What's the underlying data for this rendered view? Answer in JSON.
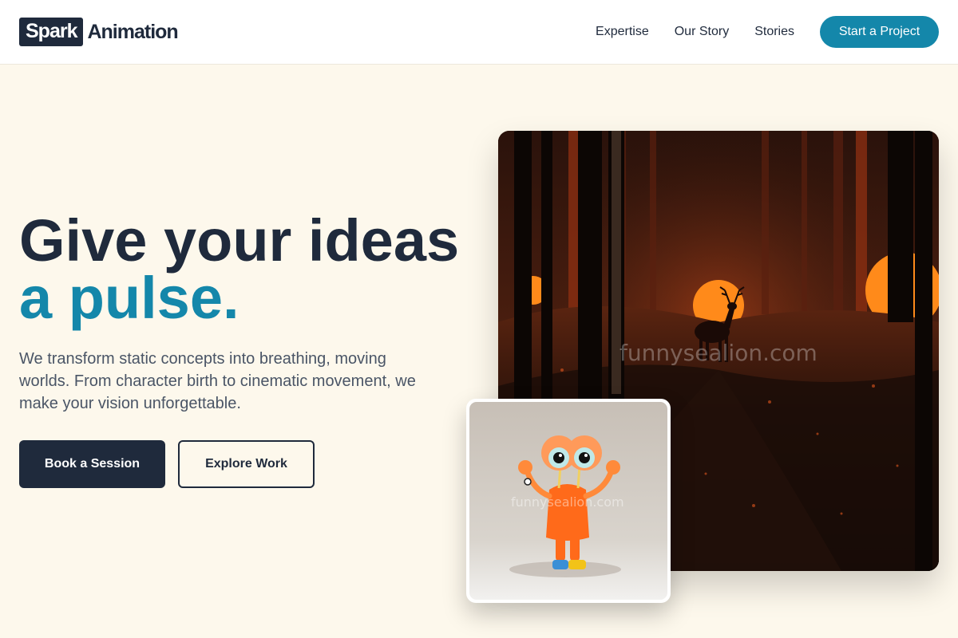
{
  "brand": {
    "box": "Spark",
    "text": "Animation"
  },
  "nav": {
    "links": [
      "Expertise",
      "Our Story",
      "Stories"
    ],
    "cta": "Start a Project"
  },
  "hero": {
    "title_line1": "Give your ideas",
    "title_line2": "a pulse.",
    "description": "We transform static concepts into breathing, moving worlds. From character birth to cinematic movement, we make your vision unforgettable.",
    "primary_button": "Book a Session",
    "secondary_button": "Explore Work"
  },
  "images": {
    "main_watermark": "funnysealion.com",
    "card_watermark": "funnysealion.com"
  },
  "colors": {
    "background": "#fdf8ec",
    "navy": "#1f2a3c",
    "accent": "#1487aa",
    "forest_orange": "#ff8a1a"
  }
}
